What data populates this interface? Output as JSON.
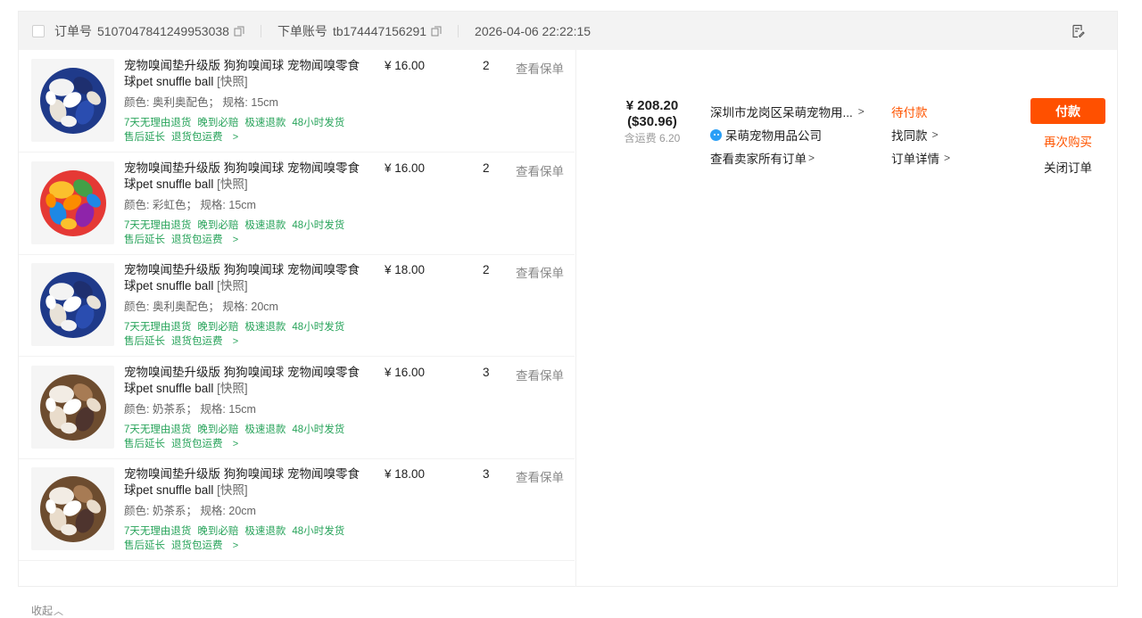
{
  "header": {
    "order_no_label": "订单号",
    "order_no": "5107047841249953038",
    "account_label": "下单账号",
    "account": "tb174447156291",
    "datetime": "2026-04-06 22:22:15"
  },
  "items": [
    {
      "title": "宠物嗅闻垫升级版 狗狗嗅闻球 宠物闻嗅零食球pet snuffle ball",
      "snapshot": "[快照]",
      "spec": "颜色: 奥利奥配色； 规格: 15cm",
      "tags": [
        "7天无理由退货",
        "晚到必赔",
        "极速退款",
        "48小时发货",
        "售后延长",
        "退货包运费"
      ],
      "price": "¥ 16.00",
      "qty": "2",
      "policy": "查看保单",
      "image": "navy-white-ball-icon"
    },
    {
      "title": "宠物嗅闻垫升级版 狗狗嗅闻球 宠物闻嗅零食球pet snuffle ball",
      "snapshot": "[快照]",
      "spec": "颜色: 彩虹色； 规格: 15cm",
      "tags": [
        "7天无理由退货",
        "晚到必赔",
        "极速退款",
        "48小时发货",
        "售后延长",
        "退货包运费"
      ],
      "price": "¥ 16.00",
      "qty": "2",
      "policy": "查看保单",
      "image": "rainbow-ball-icon"
    },
    {
      "title": "宠物嗅闻垫升级版 狗狗嗅闻球 宠物闻嗅零食球pet snuffle ball",
      "snapshot": "[快照]",
      "spec": "颜色: 奥利奥配色； 规格: 20cm",
      "tags": [
        "7天无理由退货",
        "晚到必赔",
        "极速退款",
        "48小时发货",
        "售后延长",
        "退货包运费"
      ],
      "price": "¥ 18.00",
      "qty": "2",
      "policy": "查看保单",
      "image": "navy-white-ball-icon"
    },
    {
      "title": "宠物嗅闻垫升级版 狗狗嗅闻球 宠物闻嗅零食球pet snuffle ball",
      "snapshot": "[快照]",
      "spec": "颜色: 奶茶系； 规格: 15cm",
      "tags": [
        "7天无理由退货",
        "晚到必赔",
        "极速退款",
        "48小时发货",
        "售后延长",
        "退货包运费"
      ],
      "price": "¥ 16.00",
      "qty": "3",
      "policy": "查看保单",
      "image": "milk-tea-ball-icon"
    },
    {
      "title": "宠物嗅闻垫升级版 狗狗嗅闻球 宠物闻嗅零食球pet snuffle ball",
      "snapshot": "[快照]",
      "spec": "颜色: 奶茶系； 规格: 20cm",
      "tags": [
        "7天无理由退货",
        "晚到必赔",
        "极速退款",
        "48小时发货",
        "售后延长",
        "退货包运费"
      ],
      "price": "¥ 18.00",
      "qty": "3",
      "policy": "查看保单",
      "image": "milk-tea-ball-icon"
    }
  ],
  "collapse_label": "收起",
  "total": {
    "amount": "¥ 208.20",
    "usd": "($30.96)",
    "shipping": "含运费 6.20"
  },
  "seller": {
    "address": "深圳市龙岗区呆萌宠物用...",
    "shop_name": "呆萌宠物用品公司",
    "all_orders": "查看卖家所有订单"
  },
  "status": {
    "state": "待付款",
    "find_similar": "找同款",
    "details": "订单详情"
  },
  "actions": {
    "pay": "付款",
    "rebuy": "再次购买",
    "close": "关闭订单"
  },
  "colors": {
    "accent": "#ff5000",
    "tag_green": "#27a35a",
    "header_bg": "#f3f3f3"
  }
}
